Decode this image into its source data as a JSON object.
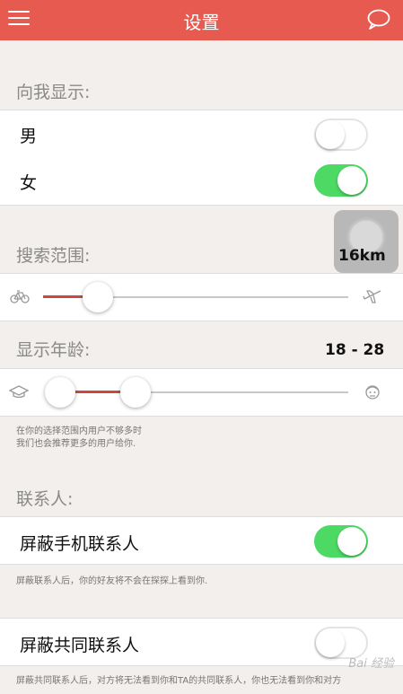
{
  "header": {
    "title": "设置",
    "menu_icon": "hamburger-icon",
    "chat_icon": "chat-bubble-icon"
  },
  "show_me": {
    "label": "向我显示:",
    "items": [
      {
        "label": "男",
        "on": false
      },
      {
        "label": "女",
        "on": true
      }
    ]
  },
  "search_range": {
    "label": "搜索范围:",
    "value": "16km",
    "level": 0.18,
    "left_icon": "bicycle-icon",
    "right_icon": "airplane-icon"
  },
  "age": {
    "label": "显示年龄:",
    "value": "18 - 28",
    "min_level": 0.05,
    "max_level": 0.3,
    "left_icon": "graduation-cap-icon",
    "right_icon": "elder-face-icon",
    "note_line1": "在你的选择范围内用户不够多时",
    "note_line2": "我们也会推荐更多的用户给你."
  },
  "contacts": {
    "label": "联系人:",
    "block_phone": {
      "label": "屏蔽手机联系人",
      "on": true,
      "note": "屏蔽联系人后，你的好友将不会在探探上看到你."
    },
    "block_common": {
      "label": "屏蔽共同联系人",
      "on": false,
      "note": "屏蔽共同联系人后，对方将无法看到你和TA的共同联系人，你也无法看到你和对方"
    }
  },
  "watermark": "Bai 经验",
  "colors": {
    "header": "#e65a4f",
    "toggle_on": "#4cd964",
    "slider_fill": "#c9493e"
  }
}
